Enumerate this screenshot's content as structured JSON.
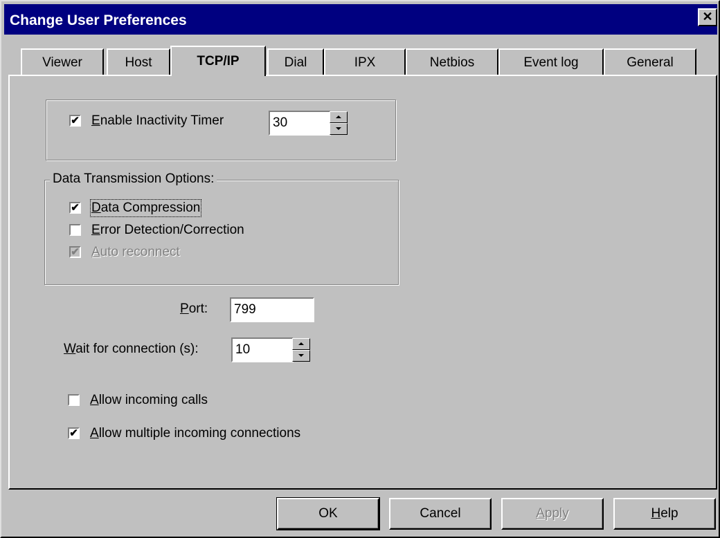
{
  "window": {
    "title": "Change User Preferences",
    "close_glyph": "✕"
  },
  "tabs": [
    {
      "label": "Viewer",
      "active": false
    },
    {
      "label": "Host",
      "active": false
    },
    {
      "label": "TCP/IP",
      "active": true
    },
    {
      "label": "Dial",
      "active": false
    },
    {
      "label": "IPX",
      "active": false
    },
    {
      "label": "Netbios",
      "active": false
    },
    {
      "label": "Event log",
      "active": false
    },
    {
      "label": "General",
      "active": false
    }
  ],
  "inactivity": {
    "checked": true,
    "label_mnemonic": "E",
    "label_rest": "nable Inactivity Timer",
    "value": "30"
  },
  "data_transmission": {
    "legend": "Data Transmission Options:",
    "compression": {
      "checked": true,
      "label_mnemonic": "D",
      "label_rest": "ata Compression"
    },
    "error_detection": {
      "checked": false,
      "label_mnemonic": "E",
      "label_rest": "rror Detection/Correction"
    },
    "auto_reconnect": {
      "checked": true,
      "disabled": true,
      "label_mnemonic": "A",
      "label_rest": "uto reconnect"
    }
  },
  "port": {
    "label_mnemonic": "P",
    "label_rest": "ort:",
    "value": "799"
  },
  "wait": {
    "label_mnemonic": "W",
    "label_rest": "ait for connection (s):",
    "value": "10"
  },
  "allow_incoming": {
    "checked": false,
    "label_mnemonic": "A",
    "label_rest": "llow incoming calls"
  },
  "allow_multiple": {
    "checked": true,
    "label_mnemonic": "A",
    "label_rest": "llow multiple incoming connections"
  },
  "buttons": {
    "ok": "OK",
    "cancel": "Cancel",
    "apply_mnemonic": "A",
    "apply_rest": "pply",
    "help_mnemonic": "H",
    "help_rest": "elp"
  },
  "check_glyph": "✔"
}
